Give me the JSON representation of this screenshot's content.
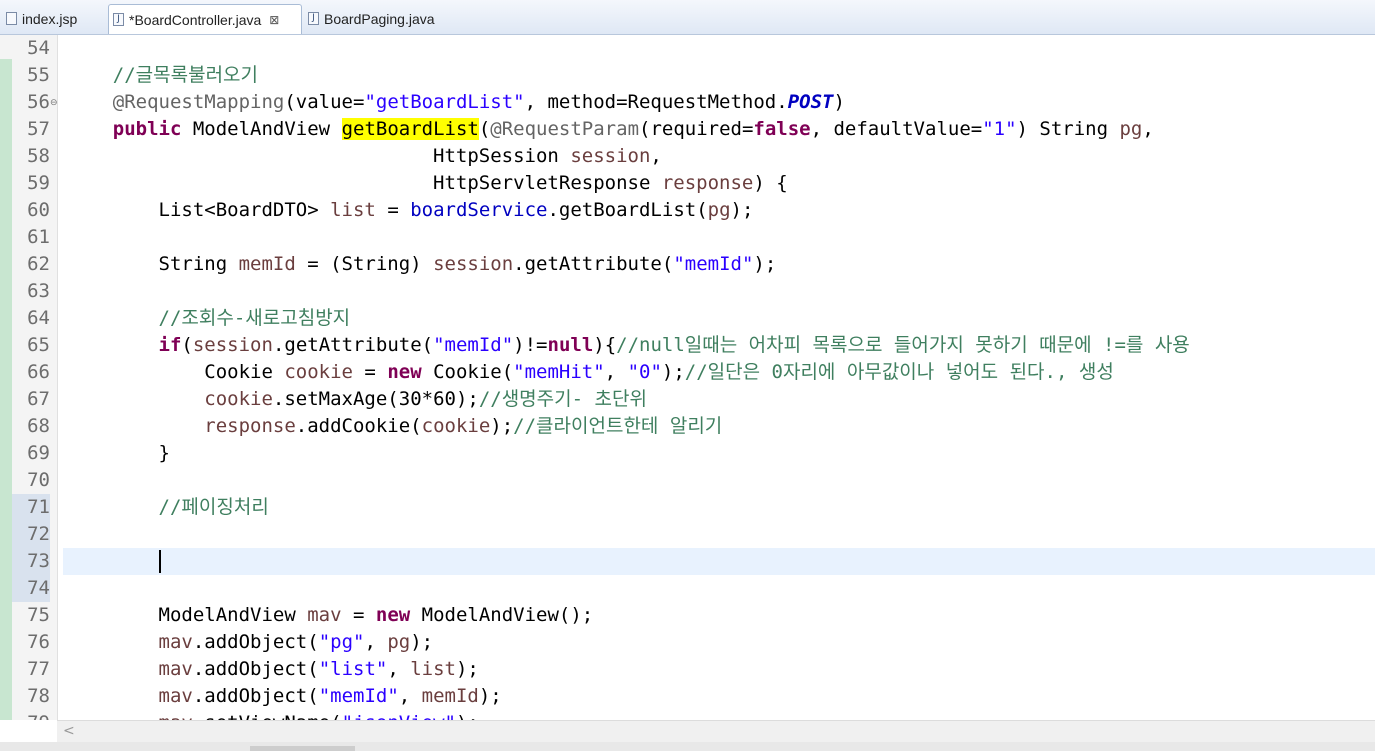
{
  "tabs": [
    {
      "label": "index.jsp",
      "icon": "jsp-file-icon",
      "active": false
    },
    {
      "label": "*BoardController.java",
      "icon": "java-file-icon",
      "active": true,
      "close": "⊠"
    },
    {
      "label": "BoardPaging.java",
      "icon": "java-file-icon",
      "active": false
    }
  ],
  "editor": {
    "first_line": 54,
    "current_line": 73,
    "selected_gutter_lines": [
      71,
      72,
      73,
      74
    ],
    "fold_marker_line": 56,
    "fold_marker": "⊖",
    "scroll_left_arrow": "<",
    "lines": [
      [],
      [
        [
          "    ",
          ""
        ],
        [
          "//글목록불러오기",
          "cm"
        ]
      ],
      [
        [
          "    ",
          ""
        ],
        [
          "@RequestMapping",
          "an"
        ],
        [
          "(value=",
          ""
        ],
        [
          "\"getBoardList\"",
          "str"
        ],
        [
          ", method=RequestMethod.",
          ""
        ],
        [
          "POST",
          "st"
        ],
        [
          ")",
          ""
        ]
      ],
      [
        [
          "    ",
          ""
        ],
        [
          "public",
          "kw"
        ],
        [
          " ModelAndView ",
          ""
        ],
        [
          "getBoardList",
          "hl"
        ],
        [
          "(",
          ""
        ],
        [
          "@RequestParam",
          "an"
        ],
        [
          "(required=",
          ""
        ],
        [
          "false",
          "kw"
        ],
        [
          ", defaultValue=",
          ""
        ],
        [
          "\"1\"",
          "str"
        ],
        [
          ") String ",
          ""
        ],
        [
          "pg",
          "var"
        ],
        [
          ",",
          ""
        ]
      ],
      [
        [
          "                                ",
          ""
        ],
        [
          "HttpSession ",
          ""
        ],
        [
          "session",
          "var"
        ],
        [
          ",",
          ""
        ]
      ],
      [
        [
          "                                ",
          ""
        ],
        [
          "HttpServletResponse ",
          ""
        ],
        [
          "response",
          "var"
        ],
        [
          ") {",
          ""
        ]
      ],
      [
        [
          "        List<BoardDTO> ",
          ""
        ],
        [
          "list",
          "var"
        ],
        [
          " = ",
          ""
        ],
        [
          "boardService",
          "fld"
        ],
        [
          ".getBoardList(",
          ""
        ],
        [
          "pg",
          "var"
        ],
        [
          ");",
          ""
        ]
      ],
      [],
      [
        [
          "        String ",
          ""
        ],
        [
          "memId",
          "var"
        ],
        [
          " = (String) ",
          ""
        ],
        [
          "session",
          "var"
        ],
        [
          ".getAttribute(",
          ""
        ],
        [
          "\"memId\"",
          "str"
        ],
        [
          ");",
          ""
        ]
      ],
      [],
      [
        [
          "        ",
          ""
        ],
        [
          "//조회수-새로고침방지",
          "cm"
        ]
      ],
      [
        [
          "        ",
          ""
        ],
        [
          "if",
          "kw"
        ],
        [
          "(",
          ""
        ],
        [
          "session",
          "var"
        ],
        [
          ".getAttribute(",
          ""
        ],
        [
          "\"memId\"",
          "str"
        ],
        [
          ")!=",
          ""
        ],
        [
          "null",
          "kw"
        ],
        [
          "){",
          ""
        ],
        [
          "//null일때는 어차피 목록으로 들어가지 못하기 때문에 !=를 사용",
          "cm"
        ]
      ],
      [
        [
          "            Cookie ",
          ""
        ],
        [
          "cookie",
          "var"
        ],
        [
          " = ",
          ""
        ],
        [
          "new",
          "kw"
        ],
        [
          " Cookie(",
          ""
        ],
        [
          "\"memHit\"",
          "str"
        ],
        [
          ", ",
          ""
        ],
        [
          "\"0\"",
          "str"
        ],
        [
          ");",
          ""
        ],
        [
          "//일단은 0자리에 아무값이나 넣어도 된다., 생성",
          "cm"
        ]
      ],
      [
        [
          "            ",
          ""
        ],
        [
          "cookie",
          "var"
        ],
        [
          ".setMaxAge(30*60);",
          ""
        ],
        [
          "//생명주기- 초단위",
          "cm"
        ]
      ],
      [
        [
          "            ",
          ""
        ],
        [
          "response",
          "var"
        ],
        [
          ".addCookie(",
          ""
        ],
        [
          "cookie",
          "var"
        ],
        [
          ");",
          ""
        ],
        [
          "//클라이언트한테 알리기",
          "cm"
        ]
      ],
      [
        [
          "        }",
          ""
        ]
      ],
      [],
      [
        [
          "        ",
          ""
        ],
        [
          "//페이징처리",
          "cm"
        ]
      ],
      [],
      [],
      [],
      [
        [
          "        ModelAndView ",
          ""
        ],
        [
          "mav",
          "var"
        ],
        [
          " = ",
          ""
        ],
        [
          "new",
          "kw"
        ],
        [
          " ModelAndView();",
          ""
        ]
      ],
      [
        [
          "        ",
          ""
        ],
        [
          "mav",
          "var"
        ],
        [
          ".addObject(",
          ""
        ],
        [
          "\"pg\"",
          "str"
        ],
        [
          ", ",
          ""
        ],
        [
          "pg",
          "var"
        ],
        [
          ");",
          ""
        ]
      ],
      [
        [
          "        ",
          ""
        ],
        [
          "mav",
          "var"
        ],
        [
          ".addObject(",
          ""
        ],
        [
          "\"list\"",
          "str"
        ],
        [
          ", ",
          ""
        ],
        [
          "list",
          "var"
        ],
        [
          ");",
          ""
        ]
      ],
      [
        [
          "        ",
          ""
        ],
        [
          "mav",
          "var"
        ],
        [
          ".addObject(",
          ""
        ],
        [
          "\"memId\"",
          "str"
        ],
        [
          ", ",
          ""
        ],
        [
          "memId",
          "var"
        ],
        [
          ");",
          ""
        ]
      ],
      [
        [
          "        ",
          ""
        ],
        [
          "mav",
          "var"
        ],
        [
          ".setViewName(",
          ""
        ],
        [
          "\"jsonView\"",
          "str"
        ],
        [
          ");",
          ""
        ]
      ]
    ]
  },
  "colors": {
    "keyword": "#7f0055",
    "comment": "#3f7f5f",
    "string": "#2a00ff",
    "annotation": "#646464",
    "field": "#0000c0",
    "local_variable": "#6a3e3e",
    "current_line": "#e8f2fe",
    "highlight": "#ffff00"
  }
}
